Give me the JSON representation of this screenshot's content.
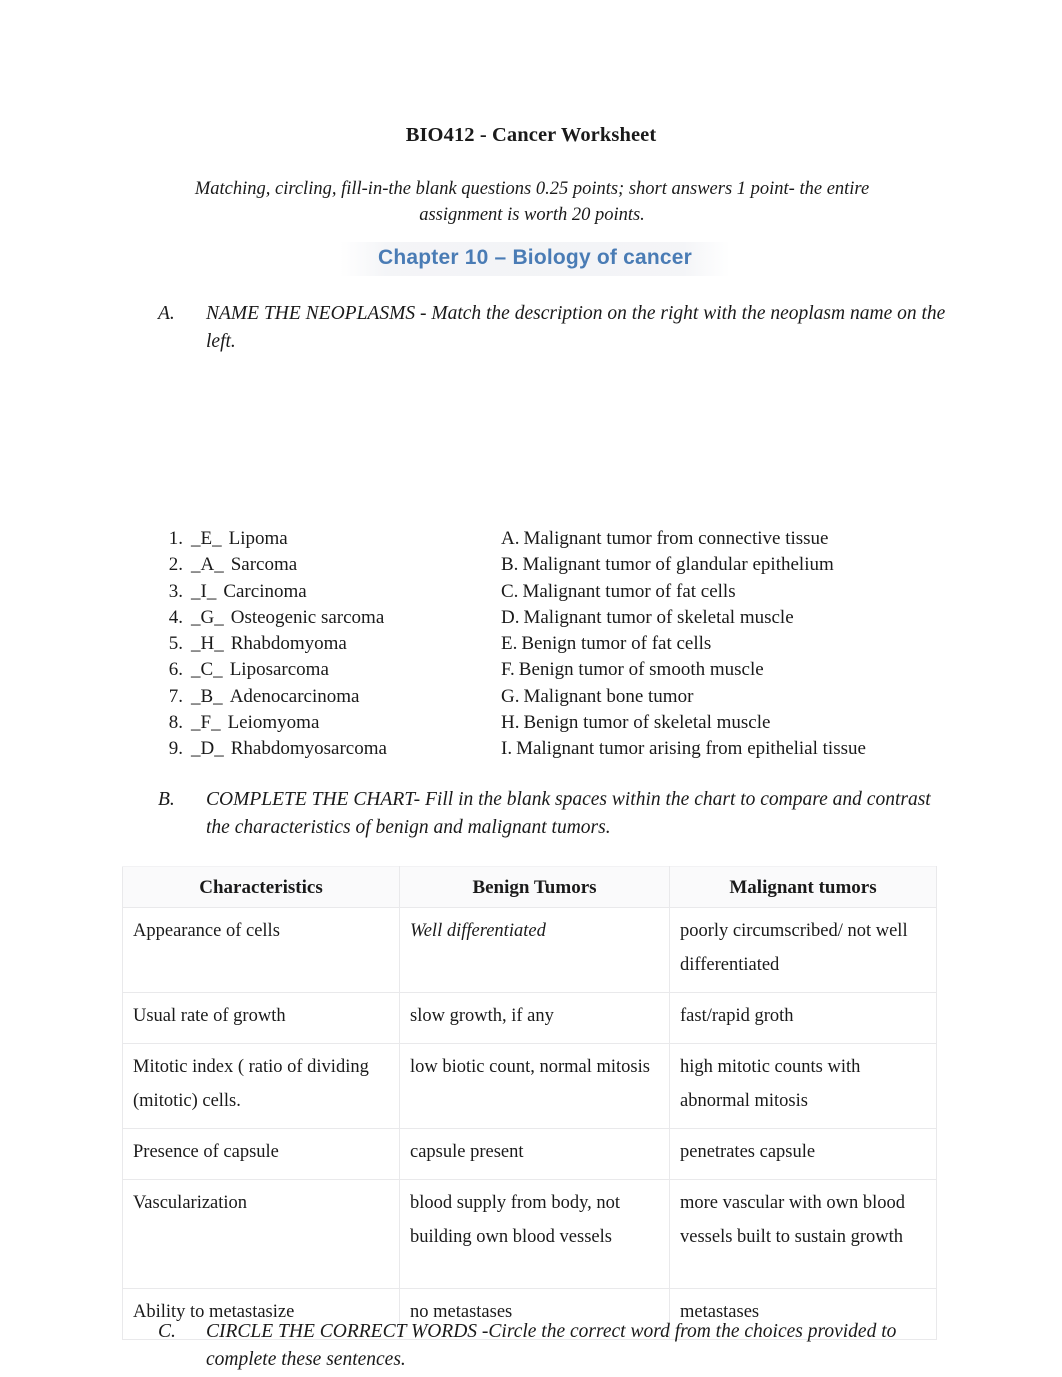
{
  "document": {
    "title": "BIO412 - Cancer Worksheet",
    "subtitle": "Matching, circling, fill-in-the blank questions 0.25 points; short answers 1 point- the entire assignment is worth 20 points.",
    "chapter_heading": "Chapter 10 – Biology of cancer",
    "accent_color": "#4a7cb5"
  },
  "sections": {
    "a": {
      "marker": "A.",
      "heading": "NAME THE NEOPLASMS",
      "instructions": " - Match the description on the right with the neoplasm name on the left."
    },
    "b": {
      "marker": "B.",
      "heading": "COMPLETE THE CHART",
      "instructions": "- Fill in the blank spaces within the chart to compare and contrast the characteristics of benign and malignant tumors."
    },
    "c": {
      "marker": "C.",
      "heading": "CIRCLE THE CORRECT WORDS",
      "instructions": " -Circle the correct word from the choices provided to complete these sentences."
    }
  },
  "matching": {
    "terms": [
      {
        "num": "1.",
        "answer": "_E_",
        "term": "Lipoma"
      },
      {
        "num": "2.",
        "answer": "_A_",
        "term": "Sarcoma"
      },
      {
        "num": "3.",
        "answer": "_I_",
        "term": "Carcinoma"
      },
      {
        "num": "4.",
        "answer": "_G_",
        "term": "Osteogenic sarcoma"
      },
      {
        "num": "5.",
        "answer": "_H_",
        "term": "Rhabdomyoma"
      },
      {
        "num": "6.",
        "answer": "_C_",
        "term": "Liposarcoma"
      },
      {
        "num": "7.",
        "answer": "_B_",
        "term": "Adenocarcinoma"
      },
      {
        "num": "8.",
        "answer": "_F_",
        "term": "Leiomyoma"
      },
      {
        "num": "9.",
        "answer": "_D_",
        "term": "Rhabdomyosarcoma"
      }
    ],
    "definitions": [
      {
        "letter": "A.",
        "text": "Malignant tumor from connective tissue"
      },
      {
        "letter": "B.",
        "text": "Malignant tumor of glandular epithelium"
      },
      {
        "letter": "C.",
        "text": "Malignant tumor of fat cells"
      },
      {
        "letter": "D.",
        "text": "Malignant tumor of skeletal muscle"
      },
      {
        "letter": "E.",
        "text": "Benign tumor of fat cells"
      },
      {
        "letter": "F.",
        "text": "Benign tumor of smooth muscle"
      },
      {
        "letter": "G.",
        "text": "Malignant bone tumor"
      },
      {
        "letter": "H.",
        "text": "Benign tumor of skeletal muscle"
      },
      {
        "letter": "I.",
        "text": "Malignant tumor arising from epithelial tissue"
      }
    ]
  },
  "chart": {
    "headers": [
      "Characteristics",
      "Benign Tumors",
      "Malignant tumors"
    ],
    "rows": [
      {
        "characteristic": "Appearance of cells",
        "benign": "Well differentiated",
        "benign_italic": true,
        "malignant": "poorly circumscribed/ not well differentiated"
      },
      {
        "characteristic": "Usual rate of growth",
        "benign": "slow growth, if any",
        "benign_italic": false,
        "malignant": "fast/rapid groth"
      },
      {
        "characteristic": "Mitotic index ( ratio of dividing (mitotic) cells.",
        "benign": "low biotic count, normal mitosis",
        "benign_italic": false,
        "malignant": "high mitotic counts with abnormal mitosis"
      },
      {
        "characteristic": "Presence of capsule",
        "benign": "capsule present",
        "benign_italic": false,
        "malignant": "penetrates capsule"
      },
      {
        "characteristic": "Vascularization",
        "benign": "blood supply from body, not building own blood vessels",
        "benign_italic": false,
        "malignant": "more vascular with own blood vessels built to sustain growth"
      },
      {
        "characteristic": "Ability to metastasize",
        "benign": "no metastases",
        "benign_italic": false,
        "malignant": "metastases"
      }
    ]
  }
}
